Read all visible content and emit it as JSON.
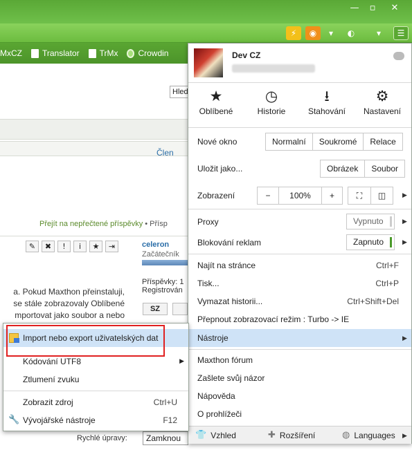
{
  "window": {
    "minimize_glyph": "—",
    "maximize_glyph": "▫",
    "close_glyph": "✕"
  },
  "toolbar": {
    "icons": [
      "lightning-icon",
      "rss-icon",
      "dropdown-icon",
      "translate-icon",
      "more-icon",
      "menu-icon"
    ]
  },
  "bookmarks": [
    {
      "label": "MxCZ"
    },
    {
      "label": "Translator"
    },
    {
      "label": "TrMx"
    },
    {
      "label": "Crowdin"
    }
  ],
  "page": {
    "search_stub": "Hled",
    "members_link": "Člen",
    "unread_link": "Přejít na nepřečtené příspěvky",
    "unread_sep": " • Přísp",
    "author": "celeron",
    "author_rank": "Začátečník",
    "posts_label": "Příspěvky: 1",
    "registered_label": "Registrován",
    "post_lines": [
      "a. Pokud Maxthon přeinstaluji,",
      "se stále zobrazovaly Oblíbené",
      "mportovat jako soubor a nebo"
    ],
    "sz_button": "SZ",
    "quick_edit_label": "Rychlé úpravy:",
    "quick_edit_value": "Zamknou"
  },
  "menu": {
    "user": {
      "name": "Dev CZ"
    },
    "quick": [
      {
        "label": "Oblíbené",
        "icon": "star-icon",
        "glyph": "★"
      },
      {
        "label": "Historie",
        "icon": "clock-icon",
        "glyph": "◷"
      },
      {
        "label": "Stahování",
        "icon": "download-icon",
        "glyph": "⭳"
      },
      {
        "label": "Nastavení",
        "icon": "gear-icon",
        "glyph": "⚙"
      }
    ],
    "new_window": {
      "label": "Nové okno",
      "options": [
        "Normalní",
        "Soukromé",
        "Relace"
      ]
    },
    "save_as": {
      "label": "Uložit jako...",
      "options": [
        "Obrázek",
        "Soubor"
      ]
    },
    "zoom": {
      "label": "Zobrazení",
      "minus": "−",
      "value": "100%",
      "plus": "+"
    },
    "proxy": {
      "label": "Proxy",
      "value": "Vypnuto"
    },
    "adblock": {
      "label": "Blokování reklam",
      "value": "Zapnuto",
      "on_color": "#4a9a2a"
    },
    "items": [
      {
        "label": "Najít na stránce",
        "shortcut": "Ctrl+F"
      },
      {
        "label": "Tisk...",
        "shortcut": "Ctrl+P"
      },
      {
        "label": "Vymazat historii...",
        "shortcut": "Ctrl+Shift+Del"
      },
      {
        "label": "Přepnout zobrazovací režim : Turbo -> IE",
        "shortcut": ""
      }
    ],
    "tools": {
      "label": "Nástroje"
    },
    "lower_items": [
      "Maxthon fórum",
      "Zašlete svůj názor",
      "Nápověda",
      "O prohlížeči"
    ],
    "footer": [
      {
        "label": "Vzhled",
        "icon": "shirt-icon"
      },
      {
        "label": "Rozšíření",
        "icon": "puzzle-icon"
      },
      {
        "label": "Languages",
        "icon": "globe-icon"
      }
    ]
  },
  "submenu": {
    "items": [
      {
        "label": "Import nebo export uživatelských dat",
        "shortcut": ""
      },
      {
        "label": "Kódování UTF8",
        "shortcut": ""
      },
      {
        "label": "Ztlumení zvuku",
        "shortcut": ""
      },
      {
        "label": "Zobrazit zdroj",
        "shortcut": "Ctrl+U"
      },
      {
        "label": "Vývojářské nástroje",
        "shortcut": "F12"
      }
    ]
  },
  "colors": {
    "highlight": "#cfe3f7",
    "annotation": "#e02020",
    "brand_green": "#6cbc3f"
  }
}
